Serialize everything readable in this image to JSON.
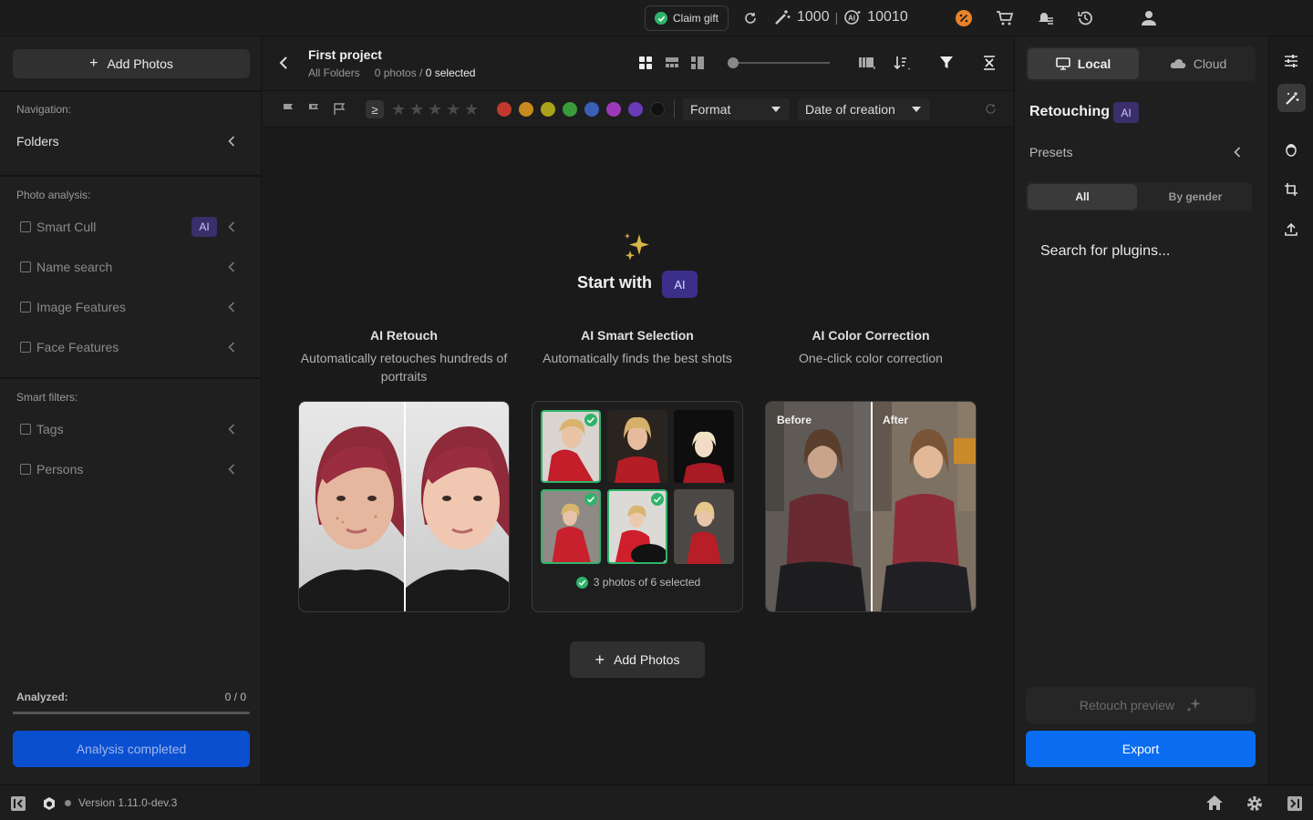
{
  "topbar": {
    "claim_gift": "Claim gift",
    "credits_retouch": "1000",
    "credits_sep": "|",
    "credits_ai": "10010"
  },
  "left": {
    "add_photos": "Add Photos",
    "navigation_label": "Navigation:",
    "folders": "Folders",
    "photo_analysis_label": "Photo analysis:",
    "analysis_items": [
      "Smart Cull",
      "Name search",
      "Image Features",
      "Face Features"
    ],
    "ai_badge": "AI",
    "smart_filters_label": "Smart filters:",
    "filter_items": [
      "Tags",
      "Persons"
    ],
    "analyzed_label": "Analyzed:",
    "analyzed_value": "0 / 0",
    "analysis_button": "Analysis completed"
  },
  "project": {
    "title": "First project",
    "breadcrumb": "All Folders",
    "photos_count": "0 photos /",
    "selected": "0 selected"
  },
  "filters": {
    "gte": "≥",
    "star_count": 5,
    "colors": [
      "#c0392b",
      "#c68a1e",
      "#a8a31a",
      "#3a9b3a",
      "#3a5fb8",
      "#9b3ab8",
      "#6a3ab8",
      "#111111"
    ],
    "format_label": "Format",
    "sort_label": "Date of creation"
  },
  "empty_state": {
    "start_with": "Start with",
    "ai": "AI",
    "features": [
      {
        "title": "AI Retouch",
        "desc": "Automatically retouches hundreds of portraits"
      },
      {
        "title": "AI Smart Selection",
        "desc": "Automatically finds the best shots"
      },
      {
        "title": "AI Color Correction",
        "desc": "One-click color correction"
      }
    ],
    "selection_caption": "3 photos of 6 selected",
    "before": "Before",
    "after": "After",
    "add_photos": "Add Photos"
  },
  "right": {
    "local": "Local",
    "cloud": "Cloud",
    "retouching": "Retouching",
    "ai": "AI",
    "presets": "Presets",
    "all": "All",
    "by_gender": "By gender",
    "search_plugins": "Search for plugins...",
    "retouch_preview": "Retouch preview",
    "export": "Export"
  },
  "bottom": {
    "version": "Version 1.11.0-dev.3"
  },
  "colors": {
    "accent": "#0a6cf0",
    "ai_badge": "#3a2f6b",
    "analysis_button": "#0a4fd0",
    "selected_check": "#2fb36a"
  }
}
